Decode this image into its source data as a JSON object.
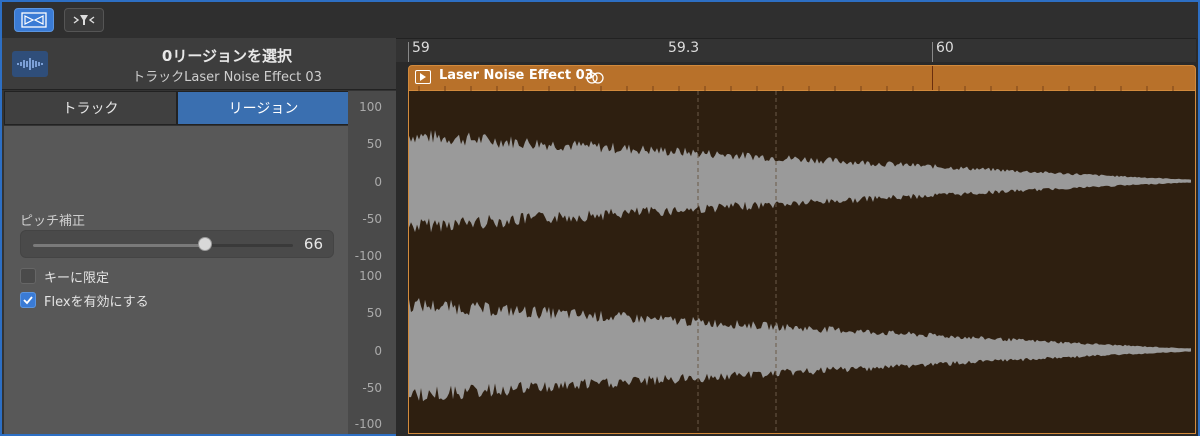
{
  "toolbar": {
    "buttons": [
      {
        "icon": "catch-flex-icon",
        "active": true
      },
      {
        "icon": "filter-funnel-icon",
        "active": false
      }
    ]
  },
  "header": {
    "title": "0リージョンを選択",
    "subtitle": "トラックLaser Noise Effect 03",
    "icon": "waveform-icon"
  },
  "tabs": [
    {
      "label": "トラック",
      "active": false
    },
    {
      "label": "リージョン",
      "active": true
    }
  ],
  "inspector": {
    "pitch_label": "ピッチ補正",
    "pitch_value": "66",
    "pitch_value_num": 66,
    "pitch_max": 100,
    "limit_key": {
      "label": "キーに限定",
      "checked": false
    },
    "enable_flex": {
      "label": "Flexを有効にする",
      "checked": true
    }
  },
  "scale": {
    "upper": [
      "100",
      "50",
      "0",
      "-50",
      "-100"
    ],
    "lower": [
      "100",
      "50",
      "0",
      "-50",
      "-100"
    ]
  },
  "ruler": {
    "labels": [
      "59",
      "59.3",
      "60"
    ]
  },
  "region": {
    "name": "Laser Noise Effect 03",
    "color": "#b8712a",
    "loop_icon": "loop-circles-icon"
  },
  "colors": {
    "accent": "#3a7bd5",
    "region": "#b8712a",
    "waveform": "#9a9a9a",
    "wave_bg": "#2e1f10"
  }
}
